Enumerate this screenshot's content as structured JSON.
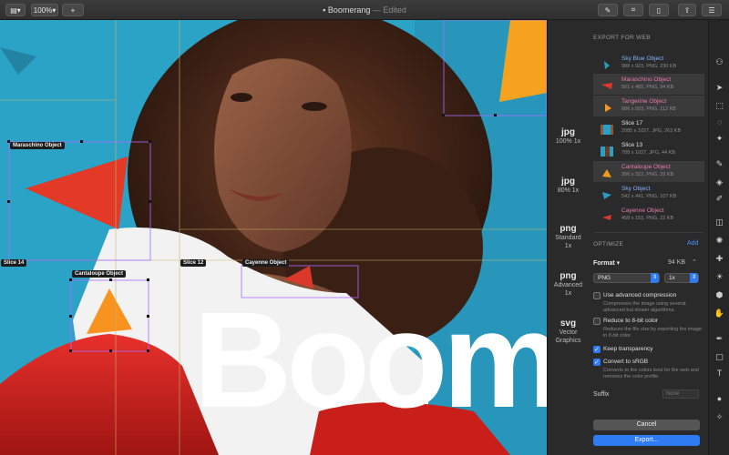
{
  "window": {
    "title": "Boomerang",
    "edited": "— Edited"
  },
  "toolbar": {
    "zoom": "100%",
    "add": "+"
  },
  "canvas": {
    "headline": "Boom",
    "slices": [
      {
        "label": "Maraschino Object"
      },
      {
        "label": "Slice 14"
      },
      {
        "label": "Cantaloupe Object"
      },
      {
        "label": "Slice 12"
      },
      {
        "label": "Cayenne Object"
      }
    ]
  },
  "formats": [
    {
      "name": "jpg",
      "line1": "100% 1x",
      "line2": ""
    },
    {
      "name": "jpg",
      "line1": "80% 1x",
      "line2": ""
    },
    {
      "name": "png",
      "line1": "Standard",
      "line2": "1x"
    },
    {
      "name": "png",
      "line1": "Advanced",
      "line2": "1x"
    },
    {
      "name": "svg",
      "line1": "Vector",
      "line2": "Graphics"
    }
  ],
  "export": {
    "heading": "EXPORT FOR WEB",
    "items": [
      {
        "name": "Sky Blue Object",
        "meta": "988 x 923, PNG, 230 KB",
        "color": "#2a9bc0"
      },
      {
        "name": "Maraschino Object",
        "meta": "561 x 465, PNG, 94 KB",
        "color": "#d93a2b"
      },
      {
        "name": "Tangerine Object",
        "meta": "686 x 593, PNG, 112 KB",
        "color": "#f39a1e"
      },
      {
        "name": "Slice 17",
        "meta": "2085 x 1027, JPG, 263 KB",
        "color": "#8a5a40"
      },
      {
        "name": "Slice 13",
        "meta": "708 x 1027, JPG, 44 KB",
        "color": "#2aa0c6"
      },
      {
        "name": "Cantaloupe Object",
        "meta": "306 x 322, PNG, 39 KB",
        "color": "#f39a1e"
      },
      {
        "name": "Sky Object",
        "meta": "542 x 441, PNG, 107 KB",
        "color": "#2a9bc0"
      },
      {
        "name": "Cayenne Object",
        "meta": "458 x 153, PNG, 22 KB",
        "color": "#d93a2b"
      }
    ]
  },
  "optimize": {
    "heading": "OPTIMIZE",
    "add": "Add",
    "format_label": "Format",
    "format_size": "94 KB",
    "format_value": "PNG",
    "scale_value": "1x",
    "options": [
      {
        "label": "Use advanced compression",
        "desc": "Compresses the image using several advanced but slower algorithms.",
        "checked": false
      },
      {
        "label": "Reduce to 8-bit color",
        "desc": "Reduces the file size by exporting the image in 8-bit color.",
        "checked": false
      },
      {
        "label": "Keep transparency",
        "desc": "",
        "checked": true
      },
      {
        "label": "Convert to sRGB",
        "desc": "Converts to the colors best for the web and removes the color profile.",
        "checked": true
      }
    ],
    "suffix_label": "Suffix",
    "suffix_placeholder": "None"
  },
  "buttons": {
    "cancel": "Cancel",
    "export": "Export..."
  },
  "colors": {
    "accent": "#2f7bf2",
    "panel": "#2a2a2a",
    "background": "#2ba3c6"
  }
}
